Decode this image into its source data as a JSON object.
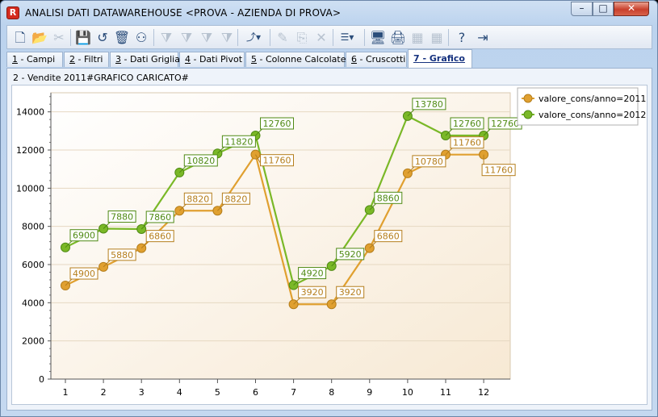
{
  "window": {
    "title": "ANALISI DATI DATAWAREHOUSE <PROVA - AZIENDA DI PROVA>",
    "min_glyph": "–",
    "max_glyph": "□",
    "close_glyph": "✕",
    "app_icon_glyph": "R"
  },
  "toolbar": {
    "buttons": [
      {
        "name": "new-document-icon",
        "glyph": "🗋"
      },
      {
        "name": "open-folder-icon",
        "glyph": "📂"
      },
      {
        "name": "cut-disabled-icon",
        "glyph": "✂"
      },
      {
        "name": "save-icon",
        "glyph": "💾"
      },
      {
        "name": "undo-icon",
        "glyph": "↺"
      },
      {
        "name": "delete-icon",
        "glyph": "🗑"
      },
      {
        "name": "binoculars-icon",
        "glyph": "⚇"
      },
      {
        "name": "filter-1-icon",
        "glyph": "⧩"
      },
      {
        "name": "filter-2-icon",
        "glyph": "⧩"
      },
      {
        "name": "filter-3-icon",
        "glyph": "⧩"
      },
      {
        "name": "filter-4-icon",
        "glyph": "⧩"
      },
      {
        "name": "chart-type-icon",
        "glyph": "⤴▾"
      },
      {
        "name": "edit-disabled-icon",
        "glyph": "✎"
      },
      {
        "name": "copy-disabled-icon",
        "glyph": "⎘"
      },
      {
        "name": "clear-disabled-icon",
        "glyph": "✕"
      },
      {
        "name": "grid-layout-icon",
        "glyph": "☰▾"
      },
      {
        "name": "monitor-icon",
        "glyph": "🖥"
      },
      {
        "name": "print-icon",
        "glyph": "🖨"
      },
      {
        "name": "export-excel-disabled-icon",
        "glyph": "▦"
      },
      {
        "name": "export-disabled-icon",
        "glyph": "▦"
      },
      {
        "name": "help-icon",
        "glyph": "?"
      },
      {
        "name": "exit-icon",
        "glyph": "⇥"
      }
    ]
  },
  "tabs": [
    {
      "key": "1",
      "label": " - Campi"
    },
    {
      "key": "2",
      "label": " - Filtri"
    },
    {
      "key": "3",
      "label": " - Dati Griglia"
    },
    {
      "key": "4",
      "label": " - Dati Pivot"
    },
    {
      "key": "5",
      "label": " - Colonne Calcolate"
    },
    {
      "key": "6",
      "label": " - Cruscotti"
    },
    {
      "key": "7",
      "label": " - Grafico"
    }
  ],
  "active_tab": "7",
  "content": {
    "heading": "2 - Vendite 2011#GRAFICO CARICATO#"
  },
  "colors": {
    "series_2011": "#e0a030",
    "series_2011_dark": "#b57e1c",
    "series_2012": "#7ab827",
    "series_2012_dark": "#4f8a14",
    "plot_bg_top": "#ffffff",
    "plot_bg_bottom": "#f7e9d4"
  },
  "chart_data": {
    "type": "line",
    "x": [
      1,
      2,
      3,
      4,
      5,
      6,
      7,
      8,
      9,
      10,
      11,
      12
    ],
    "ylim": [
      0,
      15000
    ],
    "yticks": [
      0,
      2000,
      4000,
      6000,
      8000,
      10000,
      12000,
      14000
    ],
    "grid": true,
    "legend_position": "top-right",
    "series": [
      {
        "name": "valore_cons/anno=2011",
        "values": [
          4900,
          5880,
          6860,
          8820,
          8820,
          11760,
          3920,
          3920,
          6860,
          10780,
          11760,
          11760
        ]
      },
      {
        "name": "valore_cons/anno=2012",
        "values": [
          6900,
          7880,
          7860,
          10820,
          11820,
          12760,
          4920,
          5920,
          8860,
          13780,
          12760,
          12760
        ]
      }
    ]
  }
}
